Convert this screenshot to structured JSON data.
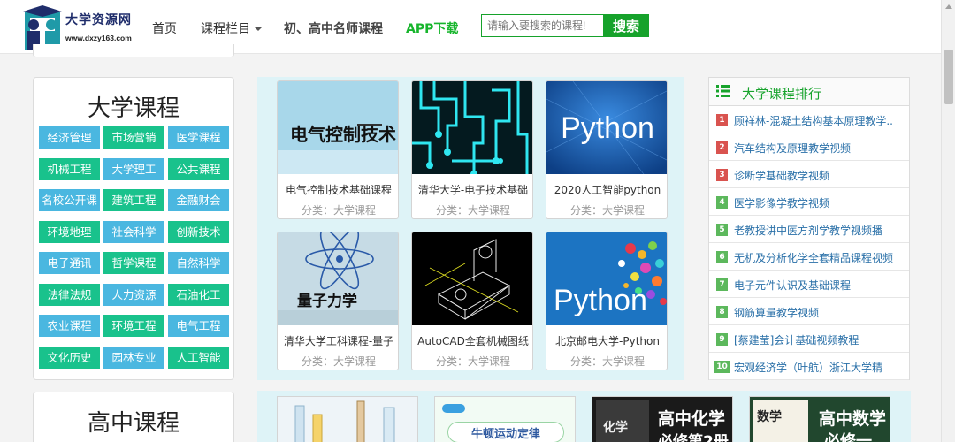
{
  "header": {
    "logo_title": "大学资源网",
    "logo_url": "www.dxzy163.com",
    "nav": {
      "home": "首页",
      "categories": "课程栏目",
      "teachers": "初、高中名师课程",
      "app": "APP下载"
    },
    "search": {
      "placeholder": "请输入要搜索的课程!",
      "button": "搜索"
    }
  },
  "left": {
    "univ_title": "大学课程",
    "univ_categories": [
      {
        "label": "经济管理",
        "color": "blue"
      },
      {
        "label": "市场营销",
        "color": "green"
      },
      {
        "label": "医学课程",
        "color": "blue"
      },
      {
        "label": "机械工程",
        "color": "green"
      },
      {
        "label": "大学理工",
        "color": "blue"
      },
      {
        "label": "公共课程",
        "color": "green"
      },
      {
        "label": "名校公开课",
        "color": "blue"
      },
      {
        "label": "建筑工程",
        "color": "green"
      },
      {
        "label": "金融财会",
        "color": "blue"
      },
      {
        "label": "环境地理",
        "color": "green"
      },
      {
        "label": "社会科学",
        "color": "blue"
      },
      {
        "label": "创新技术",
        "color": "green"
      },
      {
        "label": "电子通讯",
        "color": "blue"
      },
      {
        "label": "哲学课程",
        "color": "green"
      },
      {
        "label": "自然科学",
        "color": "blue"
      },
      {
        "label": "法律法规",
        "color": "green"
      },
      {
        "label": "人力资源",
        "color": "blue"
      },
      {
        "label": "石油化工",
        "color": "green"
      },
      {
        "label": "农业课程",
        "color": "blue"
      },
      {
        "label": "环境工程",
        "color": "green"
      },
      {
        "label": "电气工程",
        "color": "blue"
      },
      {
        "label": "文化历史",
        "color": "green"
      },
      {
        "label": "园林专业",
        "color": "blue"
      },
      {
        "label": "人工智能",
        "color": "green"
      }
    ],
    "hs_title": "高中课程"
  },
  "cards": [
    {
      "title": "电气控制技术基础课程",
      "category": "分类：大学课程",
      "thumb_text": "电气控制技术"
    },
    {
      "title": "清华大学-电子技术基础",
      "category": "分类：大学课程",
      "thumb_text": ""
    },
    {
      "title": "2020人工智能python",
      "category": "分类：大学课程",
      "thumb_text": "Python"
    },
    {
      "title": "清华大学工科课程-量子",
      "category": "分类：大学课程",
      "thumb_text": "量子力学"
    },
    {
      "title": "AutoCAD全套机械图纸",
      "category": "分类：大学课程",
      "thumb_text": ""
    },
    {
      "title": "北京邮电大学-Python",
      "category": "分类：大学课程",
      "thumb_text": "Python"
    }
  ],
  "bottom_cards": {
    "card2_text": "牛顿运动定律",
    "card3_big": "高中化学",
    "card3_sub": "必修第2册",
    "card3_book": "化学",
    "card4_big": "高中数学",
    "card4_sub": "必修一",
    "card4_book": "数学"
  },
  "ranking": {
    "title": "大学课程排行",
    "items": [
      {
        "num": "1",
        "text": "顾祥林-混凝土结构基本原理教学.."
      },
      {
        "num": "2",
        "text": "汽车结构及原理教学视频"
      },
      {
        "num": "3",
        "text": "诊断学基础教学视频"
      },
      {
        "num": "4",
        "text": "医学影像学教学视频"
      },
      {
        "num": "5",
        "text": "老教授讲中医方剂学教学视频播"
      },
      {
        "num": "6",
        "text": "无机及分析化学全套精品课程视频"
      },
      {
        "num": "7",
        "text": "电子元件认识及基础课程"
      },
      {
        "num": "8",
        "text": "钢筋算量教学视频"
      },
      {
        "num": "9",
        "text": "[蔡建莹]会计基础视频教程"
      },
      {
        "num": "10",
        "text": "宏观经济学（叶航）浙江大学精"
      }
    ]
  },
  "colors": {
    "accent_green": "#16a22b",
    "cat_blue": "#4ab7e0",
    "cat_green": "#19c28c",
    "rank_red": "#d9534f",
    "rank_green": "#5cb85c"
  }
}
